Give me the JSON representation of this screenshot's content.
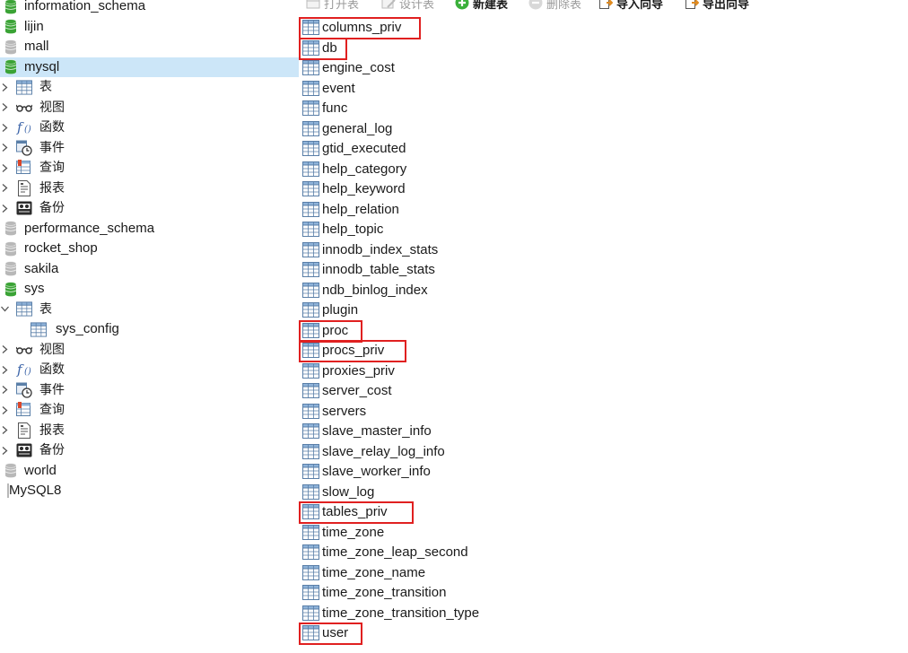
{
  "navigator": {
    "selected": "mysql",
    "rows": [
      {
        "kind": "db",
        "label": "information_schema",
        "icon": "database-icon-open",
        "level": 0
      },
      {
        "kind": "db",
        "label": "lijin",
        "icon": "database-icon-open",
        "level": 0
      },
      {
        "kind": "db",
        "label": "mall",
        "icon": "database-icon-closed",
        "level": 0
      },
      {
        "kind": "db",
        "label": "mysql",
        "icon": "database-icon-open",
        "level": 0,
        "selected": true
      },
      {
        "kind": "group",
        "label": "表",
        "icon": "table-icon",
        "level": 1,
        "expanded": false
      },
      {
        "kind": "group",
        "label": "视图",
        "icon": "view-icon",
        "level": 1,
        "expanded": false
      },
      {
        "kind": "group",
        "label": "函数",
        "icon": "function-icon",
        "level": 1,
        "expanded": false
      },
      {
        "kind": "group",
        "label": "事件",
        "icon": "event-icon",
        "level": 1,
        "expanded": false
      },
      {
        "kind": "group",
        "label": "查询",
        "icon": "query-icon",
        "level": 1,
        "expanded": false
      },
      {
        "kind": "group",
        "label": "报表",
        "icon": "report-icon",
        "level": 1,
        "expanded": false
      },
      {
        "kind": "group",
        "label": "备份",
        "icon": "backup-icon",
        "level": 1,
        "expanded": false
      },
      {
        "kind": "db",
        "label": "performance_schema",
        "icon": "database-icon-closed",
        "level": 0
      },
      {
        "kind": "db",
        "label": "rocket_shop",
        "icon": "database-icon-closed",
        "level": 0
      },
      {
        "kind": "db",
        "label": "sakila",
        "icon": "database-icon-closed",
        "level": 0
      },
      {
        "kind": "db",
        "label": "sys",
        "icon": "database-icon-open",
        "level": 0
      },
      {
        "kind": "group",
        "label": "表",
        "icon": "table-icon",
        "level": 1,
        "expanded": true
      },
      {
        "kind": "table",
        "label": "sys_config",
        "icon": "table-icon",
        "level": 2
      },
      {
        "kind": "group",
        "label": "视图",
        "icon": "view-icon",
        "level": 1,
        "expanded": false
      },
      {
        "kind": "group",
        "label": "函数",
        "icon": "function-icon",
        "level": 1,
        "expanded": false
      },
      {
        "kind": "group",
        "label": "事件",
        "icon": "event-icon",
        "level": 1,
        "expanded": false
      },
      {
        "kind": "group",
        "label": "查询",
        "icon": "query-icon",
        "level": 1,
        "expanded": false
      },
      {
        "kind": "group",
        "label": "报表",
        "icon": "report-icon",
        "level": 1,
        "expanded": false
      },
      {
        "kind": "group",
        "label": "备份",
        "icon": "backup-icon",
        "level": 1,
        "expanded": false
      },
      {
        "kind": "db",
        "label": "world",
        "icon": "database-icon-closed",
        "level": 0
      },
      {
        "kind": "conn",
        "label": "MySQL8",
        "icon": "connection-icon",
        "level": -1
      }
    ]
  },
  "toolbar": {
    "buttons": [
      {
        "label": "打开表",
        "icon": "open-table-icon",
        "enabled": false
      },
      {
        "label": "设计表",
        "icon": "design-table-icon",
        "enabled": false
      },
      {
        "label": "新建表",
        "icon": "new-table-icon",
        "enabled": true
      },
      {
        "label": "删除表",
        "icon": "delete-table-icon",
        "enabled": false
      },
      {
        "label": "导入向导",
        "icon": "import-wizard-icon",
        "enabled": true
      },
      {
        "label": "导出向导",
        "icon": "export-wizard-icon",
        "enabled": true
      }
    ]
  },
  "tables": [
    {
      "name": "columns_priv",
      "highlighted": true
    },
    {
      "name": "db",
      "highlighted": true
    },
    {
      "name": "engine_cost",
      "highlighted": false
    },
    {
      "name": "event",
      "highlighted": false
    },
    {
      "name": "func",
      "highlighted": false
    },
    {
      "name": "general_log",
      "highlighted": false
    },
    {
      "name": "gtid_executed",
      "highlighted": false
    },
    {
      "name": "help_category",
      "highlighted": false
    },
    {
      "name": "help_keyword",
      "highlighted": false
    },
    {
      "name": "help_relation",
      "highlighted": false
    },
    {
      "name": "help_topic",
      "highlighted": false
    },
    {
      "name": "innodb_index_stats",
      "highlighted": false
    },
    {
      "name": "innodb_table_stats",
      "highlighted": false
    },
    {
      "name": "ndb_binlog_index",
      "highlighted": false
    },
    {
      "name": "plugin",
      "highlighted": false
    },
    {
      "name": "proc",
      "highlighted": true
    },
    {
      "name": "procs_priv",
      "highlighted": true
    },
    {
      "name": "proxies_priv",
      "highlighted": false
    },
    {
      "name": "server_cost",
      "highlighted": false
    },
    {
      "name": "servers",
      "highlighted": false
    },
    {
      "name": "slave_master_info",
      "highlighted": false
    },
    {
      "name": "slave_relay_log_info",
      "highlighted": false
    },
    {
      "name": "slave_worker_info",
      "highlighted": false
    },
    {
      "name": "slow_log",
      "highlighted": false
    },
    {
      "name": "tables_priv",
      "highlighted": true
    },
    {
      "name": "time_zone",
      "highlighted": false
    },
    {
      "name": "time_zone_leap_second",
      "highlighted": false
    },
    {
      "name": "time_zone_name",
      "highlighted": false
    },
    {
      "name": "time_zone_transition",
      "highlighted": false
    },
    {
      "name": "time_zone_transition_type",
      "highlighted": false
    },
    {
      "name": "user",
      "highlighted": true
    }
  ],
  "colors": {
    "selection": "#cce6f8",
    "db_open": "#3aa335",
    "db_closed": "#b8b8b8",
    "highlight_box": "#e02020",
    "table_icon_border": "#5a7fa8"
  }
}
